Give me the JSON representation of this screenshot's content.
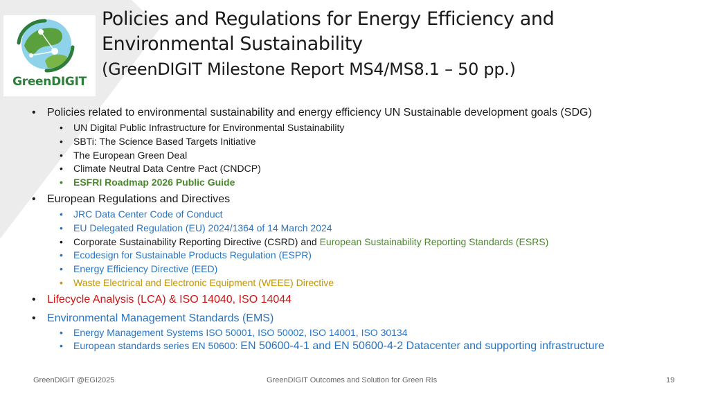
{
  "logo": {
    "text": "GreenDIGIT"
  },
  "title": {
    "line1": "Policies and Regulations for Energy Efficiency and",
    "line2": "Environmental Sustainability",
    "line3": "(GreenDIGIT Milestone Report MS4/MS8.1 – 50 pp.)"
  },
  "bullets": {
    "b1": "Policies related to environmental sustainability and energy efficiency UN Sustainable development goals (SDG)",
    "b1_items": [
      "UN Digital Public Infrastructure for Environmental Sustainability",
      "SBTi: The Science Based Targets Initiative",
      "The European Green Deal",
      "Climate Neutral Data Centre Pact (CNDCP)",
      "ESFRI Roadmap 2026 Public Guide"
    ],
    "b2": "European Regulations and Directives",
    "b2_items": {
      "jrc": "JRC Data Center Code of Conduct",
      "eu_delegated": "EU Delegated Regulation (EU) 2024/1364 of 14 March 2024",
      "csrd": "Corporate Sustainability Reporting Directive (CSRD) and",
      "esrs": "European Sustainability Reporting Standards (ESRS)",
      "espr": "Ecodesign for Sustainable Products Regulation (ESPR)",
      "eed": "Energy Efficiency Directive (EED)",
      "weee": "Waste Electrical and Electronic Equipment (WEEE) Directive"
    },
    "b3": "Lifecycle Analysis (LCA) & ISO 14040, ISO 14044",
    "b4": "Environmental Management Standards (EMS)",
    "b4_items": {
      "energy_mgmt": "Energy Management Systems ISO 50001, ISO 50002, ISO 14001, ISO 30134",
      "en50600_a": "European standards series EN 50600:",
      "en50600_b": "EN 50600-4-1 and EN 50600-4-2 Datacenter and supporting infrastructure"
    }
  },
  "footer": {
    "left": "GreenDIGIT @EGI2025",
    "center": "GreenDIGIT Outcomes and Solution for Green RIs",
    "page": "19"
  },
  "colors": {
    "accent_blue": "#2775c4",
    "accent_green": "#4a8a2b",
    "accent_gold": "#c39400",
    "accent_red": "#d01515"
  }
}
